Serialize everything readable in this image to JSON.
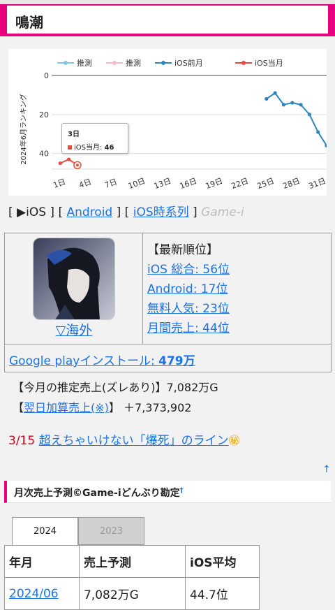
{
  "page_title": "鳴潮",
  "chart_data": {
    "type": "line",
    "ylabel": "2024年6月ランキング",
    "ylim": [
      0,
      48
    ],
    "y_ticks": [
      "0",
      "20",
      "40"
    ],
    "x_ticks": [
      "1日",
      "4日",
      "7日",
      "10日",
      "13日",
      "16日",
      "19日",
      "22日",
      "25日",
      "28日",
      "31日"
    ],
    "series": [
      {
        "name": "推測",
        "color": "#7ec8e3",
        "points": []
      },
      {
        "name": "推測",
        "color": "#f8bbd0",
        "points": []
      },
      {
        "name": "iOS前月",
        "color": "#2e86c1",
        "points": [
          [
            25,
            12
          ],
          [
            26,
            9
          ],
          [
            27,
            15
          ],
          [
            28,
            14
          ],
          [
            29,
            15
          ],
          [
            30,
            20
          ],
          [
            31,
            29
          ],
          [
            32,
            36
          ]
        ]
      },
      {
        "name": "iOS当月",
        "color": "#e74c3c",
        "points": [
          [
            1,
            45
          ],
          [
            2,
            43
          ],
          [
            3,
            46
          ]
        ]
      }
    ],
    "grid": true,
    "legend": "top"
  },
  "tooltip": {
    "day": "3日",
    "label": "iOS当月:",
    "value": "46"
  },
  "nav": {
    "open": "[",
    "ios": "▶iOS",
    "sep1": "] [",
    "android": "Android",
    "sep2": "] [",
    "ios_series": "iOS時系列",
    "close": "]",
    "gamei": "Game-i"
  },
  "info": {
    "overseas": "▽海外",
    "ranks_head": "【最新順位】",
    "ios_total": "iOS 総合: 56位",
    "android": "Android: 17位",
    "free": "無料人気: 23位",
    "monthly": "月間売上: 44位",
    "install_label": "Google playインストール:",
    "install_value": "479万"
  },
  "sales": {
    "monthly_estimate": "【今月の推定売上(ズレあり)】7,082万G",
    "next_day_open": "【",
    "next_day_link": "翌日加算売上(※)",
    "next_day_close": "】 ＋7,373,902"
  },
  "news": {
    "date": "3/15",
    "text": "超えちゃいけない「爆死」のライン",
    "icon": "㊙"
  },
  "up_arrow": "↑",
  "section": {
    "title": "月次売上予測©Game-iどんぶり勘定",
    "mark": "†"
  },
  "year_tabs": [
    "2024",
    "2023"
  ],
  "table": {
    "headers": [
      "年月",
      "売上予測",
      "iOS平均"
    ],
    "rows": [
      [
        "2024/06",
        "7,082万G",
        "44.7位"
      ]
    ]
  }
}
